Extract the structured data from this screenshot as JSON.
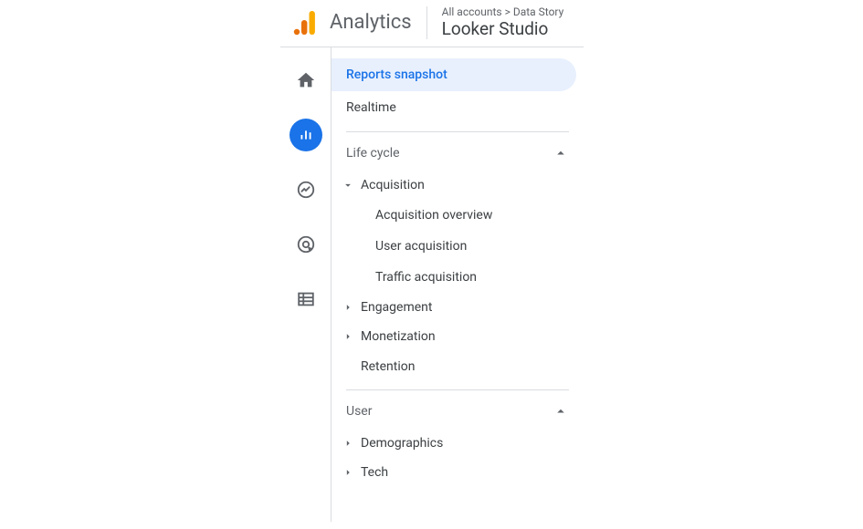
{
  "header": {
    "app_title": "Analytics",
    "breadcrumb": "All accounts > Data Story",
    "workspace_title": "Looker Studio"
  },
  "panel": {
    "reports_snapshot": "Reports snapshot",
    "realtime": "Realtime",
    "sections": {
      "life_cycle": {
        "title": "Life cycle",
        "acquisition": {
          "label": "Acquisition",
          "children": {
            "overview": "Acquisition overview",
            "user": "User acquisition",
            "traffic": "Traffic acquisition"
          }
        },
        "engagement": "Engagement",
        "monetization": "Monetization",
        "retention": "Retention"
      },
      "user": {
        "title": "User",
        "demographics": "Demographics",
        "tech": "Tech"
      }
    }
  }
}
